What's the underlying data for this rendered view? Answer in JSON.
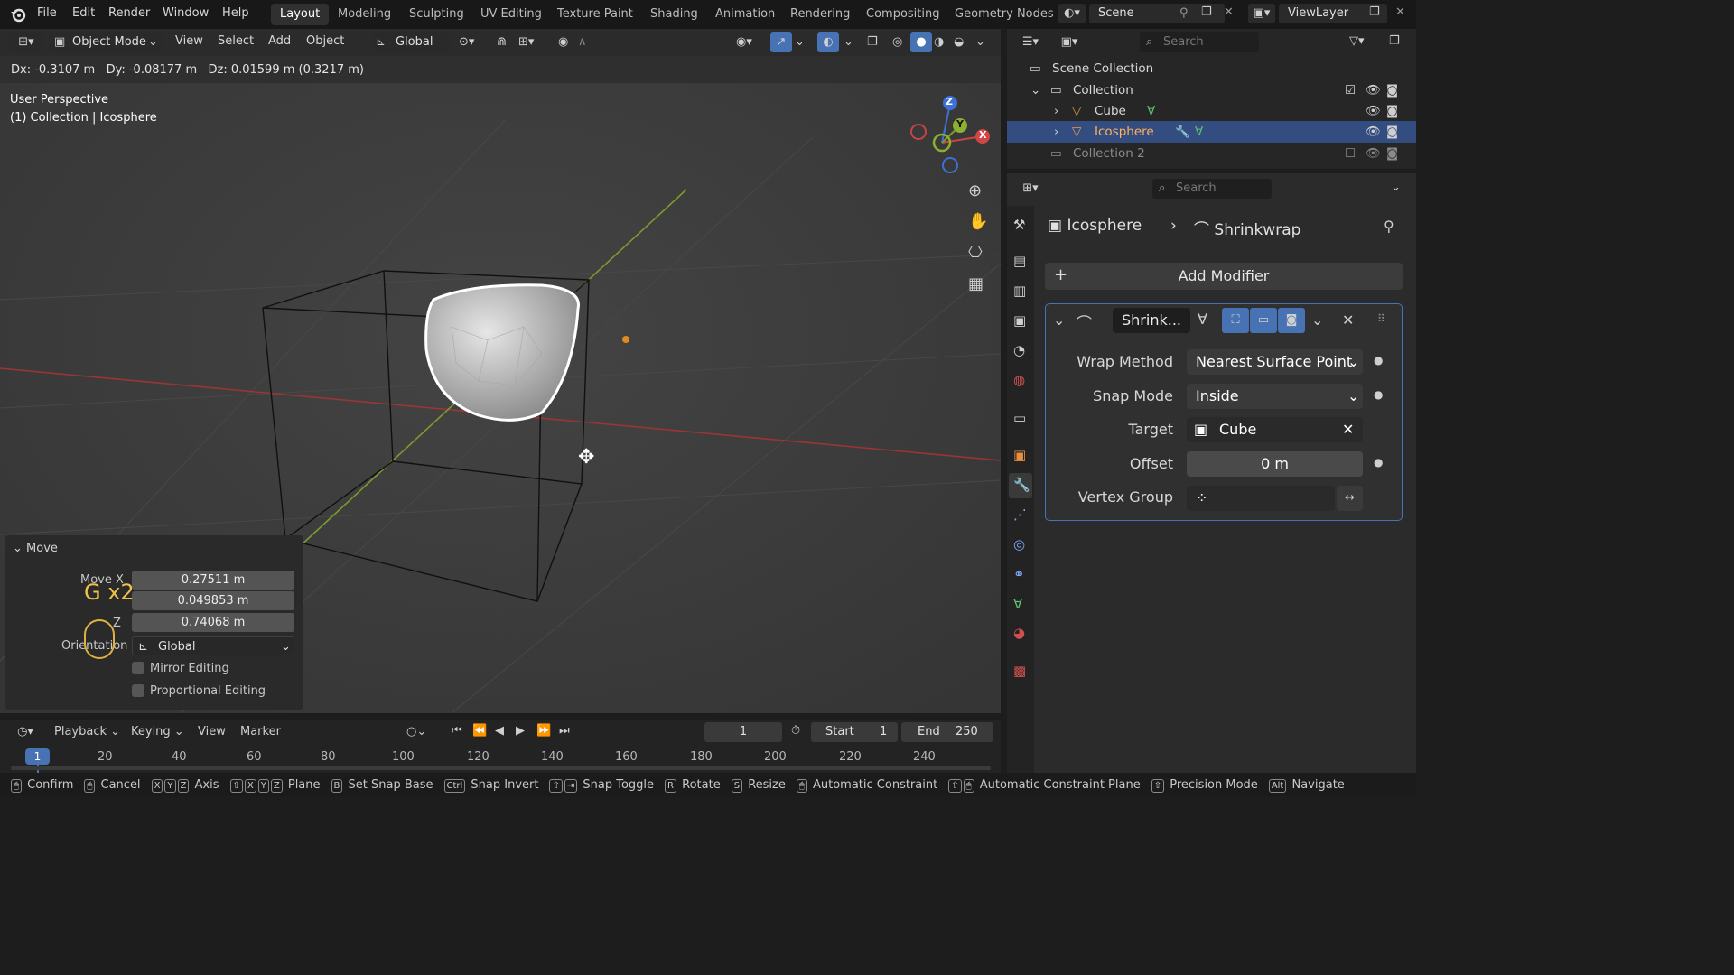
{
  "menu": [
    "File",
    "Edit",
    "Render",
    "Window",
    "Help"
  ],
  "workspaces": [
    "Layout",
    "Modeling",
    "Sculpting",
    "UV Editing",
    "Texture Paint",
    "Shading",
    "Animation",
    "Rendering",
    "Compositing",
    "Geometry Nodes"
  ],
  "scene": {
    "label": "Scene",
    "view_layer": "ViewLayer"
  },
  "viewport_header": {
    "mode": "Object Mode",
    "view": "View",
    "select": "Select",
    "add": "Add",
    "object": "Object",
    "orientation": "Global"
  },
  "transform_readout": "Dx: -0.3107 m   Dy: -0.08177 m   Dz: 0.01599 m (0.3217 m)",
  "viewport_info": {
    "perspective": "User Perspective",
    "collection": "(1) Collection | Icosphere"
  },
  "gizmo": {
    "x": "X",
    "y": "Y",
    "z": "Z"
  },
  "outliner": {
    "search_placeholder": "Search",
    "scene_collection": "Scene Collection",
    "collection": "Collection",
    "cube": "Cube",
    "icosphere": "Icosphere",
    "collection2": "Collection 2"
  },
  "properties": {
    "search_placeholder": "Search",
    "breadcrumb_object": "Icosphere",
    "breadcrumb_modifier": "Shrinkwrap",
    "add_modifier": "Add Modifier",
    "modifier_name": "Shrink...",
    "wrap_method_label": "Wrap Method",
    "wrap_method_value": "Nearest Surface Point",
    "snap_mode_label": "Snap Mode",
    "snap_mode_value": "Inside",
    "target_label": "Target",
    "target_value": "Cube",
    "offset_label": "Offset",
    "offset_value": "0 m",
    "vertex_group_label": "Vertex Group"
  },
  "move_panel": {
    "title": "Move",
    "move_x_label": "Move X",
    "z_label": "Z",
    "x": "0.27511 m",
    "y": "0.049853 m",
    "z": "0.74068 m",
    "orientation_label": "Orientation",
    "orientation_value": "Global",
    "mirror_editing": "Mirror Editing",
    "proportional_editing": "Proportional Editing",
    "key_overlay": "G x2"
  },
  "timeline": {
    "playback": "Playback",
    "keying": "Keying",
    "view": "View",
    "marker": "Marker",
    "current_frame": "1",
    "start_label": "Start",
    "start": "1",
    "end_label": "End",
    "end": "250",
    "ticks": [
      "20",
      "40",
      "60",
      "80",
      "100",
      "120",
      "140",
      "160",
      "180",
      "200",
      "220",
      "240"
    ],
    "frame_badge": "1"
  },
  "statusbar": [
    {
      "keys": [
        "🖱"
      ],
      "label": "Confirm"
    },
    {
      "keys": [
        "🖱"
      ],
      "label": "Cancel"
    },
    {
      "keys": [
        "X",
        "Y",
        "Z"
      ],
      "label": "Axis"
    },
    {
      "keys": [
        "⇧",
        "X",
        "Y",
        "Z"
      ],
      "label": "Plane"
    },
    {
      "keys": [
        "B"
      ],
      "label": "Set Snap Base"
    },
    {
      "keys": [
        "Ctrl"
      ],
      "label": "Snap Invert"
    },
    {
      "keys": [
        "⇧",
        "⇥"
      ],
      "label": "Snap Toggle"
    },
    {
      "keys": [
        "R"
      ],
      "label": "Rotate"
    },
    {
      "keys": [
        "S"
      ],
      "label": "Resize"
    },
    {
      "keys": [
        "🖱"
      ],
      "label": "Automatic Constraint"
    },
    {
      "keys": [
        "⇧",
        "🖱"
      ],
      "label": "Automatic Constraint Plane"
    },
    {
      "keys": [
        "⇧"
      ],
      "label": "Precision Mode"
    },
    {
      "keys": [
        "Alt"
      ],
      "label": "Navigate"
    }
  ],
  "colors": {
    "accent": "#4772b3",
    "x_axis": "#a63a3a",
    "y_axis": "#7a9a2a",
    "z_axis": "#3d6fd6",
    "selection_row": "#334d80"
  }
}
